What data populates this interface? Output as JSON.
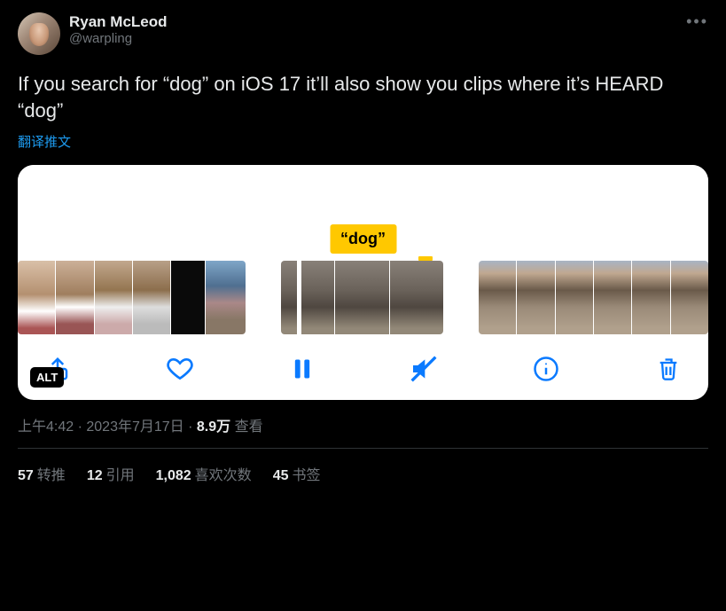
{
  "author": {
    "display_name": "Ryan McLeod",
    "handle": "@warpling"
  },
  "body": "If you search for “dog” on iOS 17 it’ll also show you clips where it’s HEARD “dog”",
  "translate_label": "翻译推文",
  "media": {
    "pill_label": "“dog”",
    "alt_badge": "ALT"
  },
  "meta": {
    "time": "上午4:42",
    "sep1": " · ",
    "date": "2023年7月17日",
    "sep2": " · ",
    "views_num": "8.9万",
    "views_label": " 查看"
  },
  "stats": {
    "retweets": {
      "num": "57",
      "label": "转推"
    },
    "quotes": {
      "num": "12",
      "label": "引用"
    },
    "likes": {
      "num": "1,082",
      "label": "喜欢次数"
    },
    "bookmarks": {
      "num": "45",
      "label": "书签"
    }
  }
}
